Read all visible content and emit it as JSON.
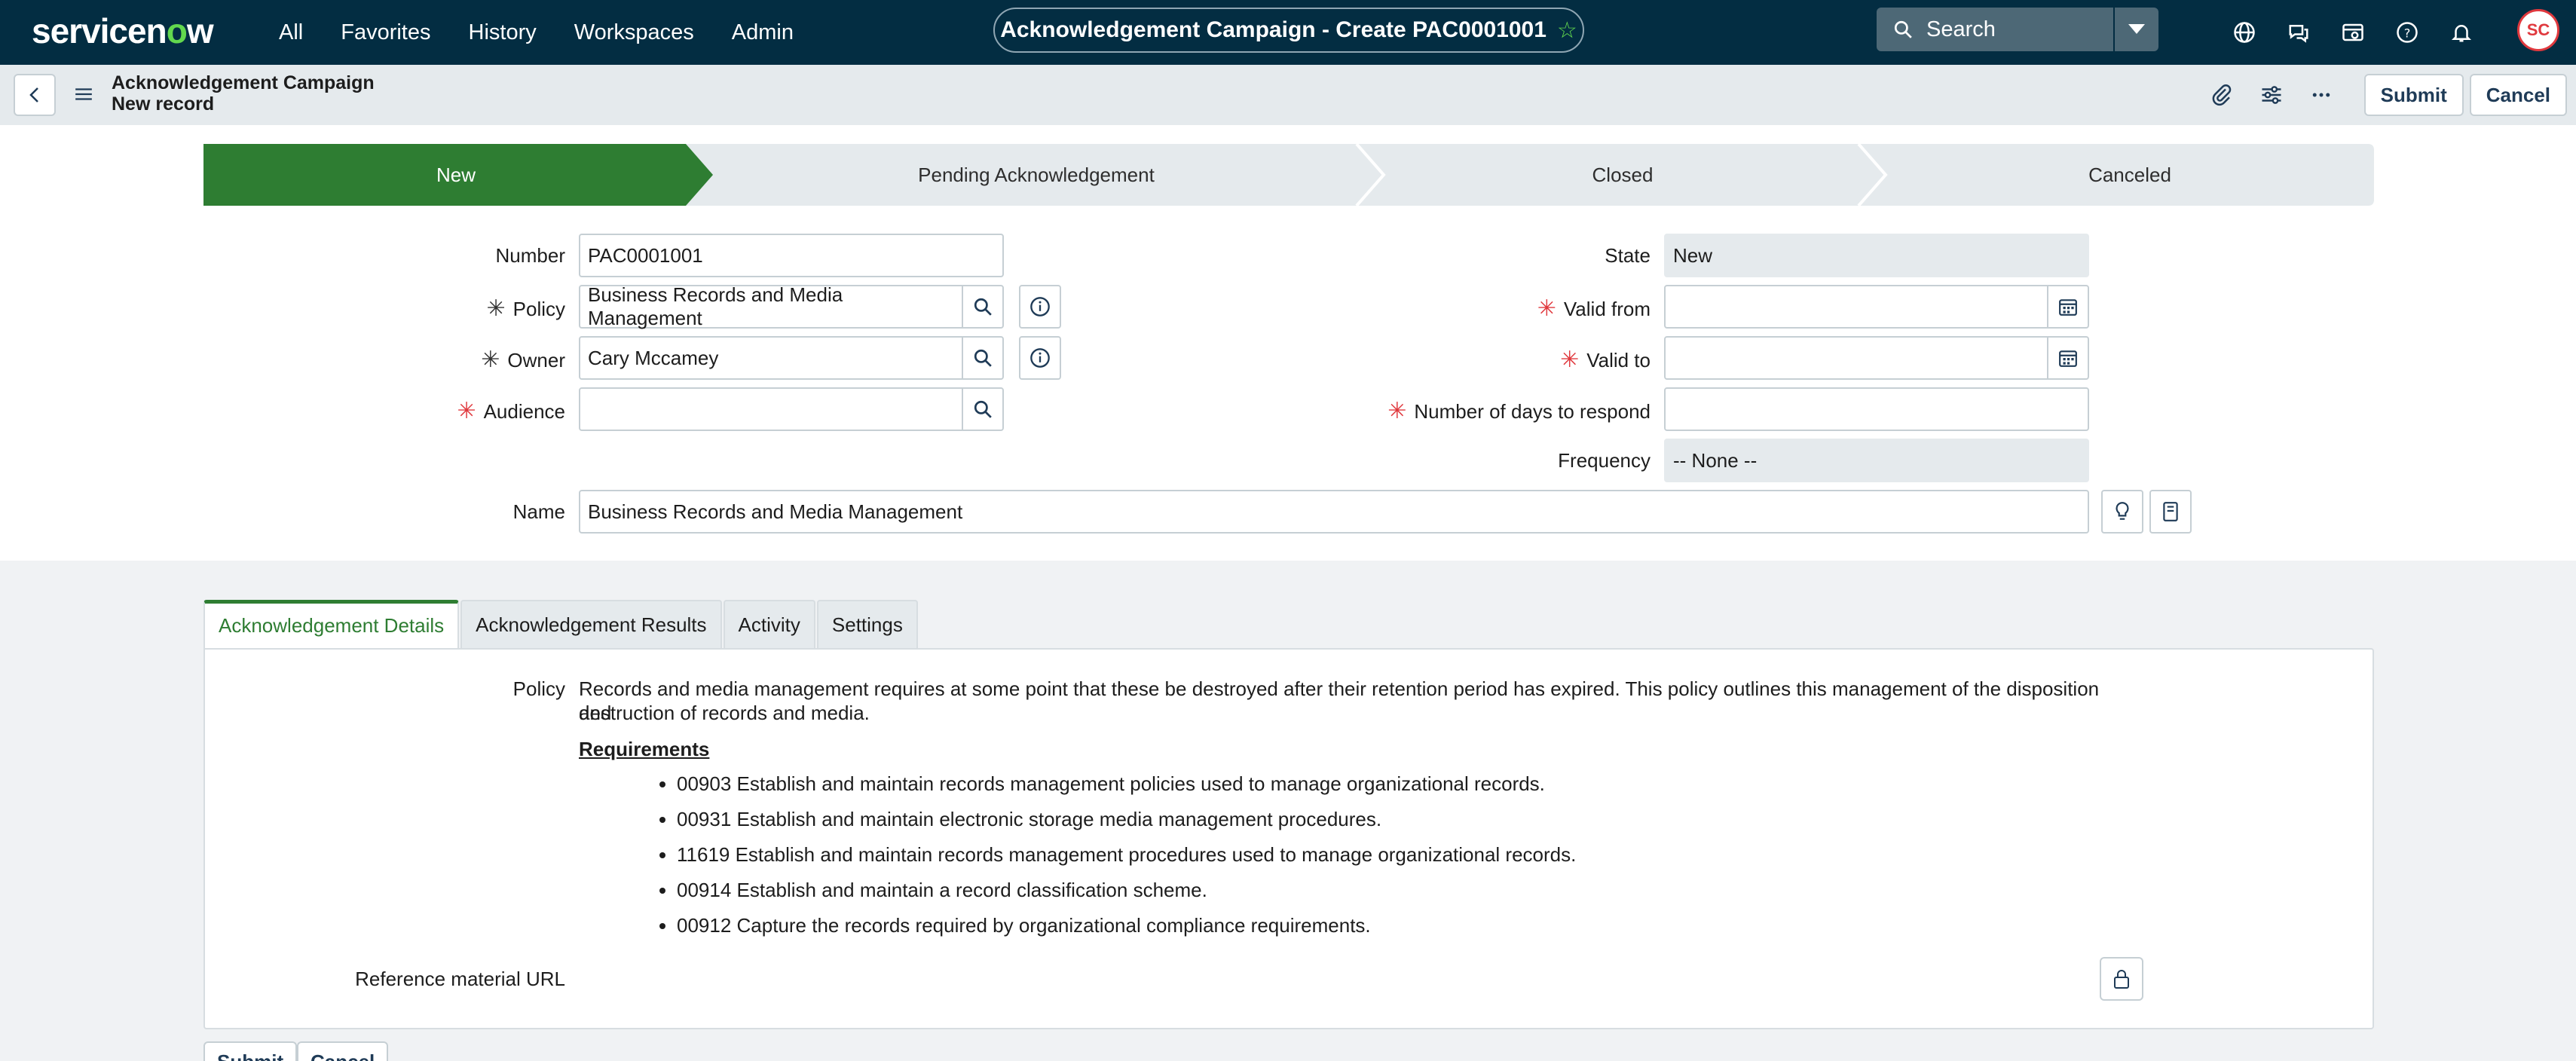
{
  "brand": {
    "name_a": "servicen",
    "name_o": "o",
    "name_b": "w"
  },
  "nav": {
    "links": [
      "All",
      "Favorites",
      "History",
      "Workspaces",
      "Admin"
    ]
  },
  "window": {
    "title": "Acknowledgement Campaign - Create PAC0001001"
  },
  "search": {
    "placeholder": "Search"
  },
  "user": {
    "initials": "SC"
  },
  "header": {
    "line1": "Acknowledgement Campaign",
    "line2": "New record",
    "submit": "Submit",
    "cancel": "Cancel"
  },
  "stages": [
    "New",
    "Pending Acknowledgement",
    "Closed",
    "Canceled"
  ],
  "form": {
    "number": {
      "label": "Number",
      "value": "PAC0001001"
    },
    "policy": {
      "label": "Policy",
      "value": "Business Records and Media Management"
    },
    "owner": {
      "label": "Owner",
      "value": "Cary Mccamey"
    },
    "audience": {
      "label": "Audience",
      "value": ""
    },
    "state": {
      "label": "State",
      "value": "New"
    },
    "valid_from": {
      "label": "Valid from",
      "value": ""
    },
    "valid_to": {
      "label": "Valid to",
      "value": ""
    },
    "days_to_respond": {
      "label": "Number of days to respond",
      "value": ""
    },
    "frequency": {
      "label": "Frequency",
      "value": "-- None --"
    },
    "name": {
      "label": "Name",
      "value": "Business Records and Media Management"
    }
  },
  "tabs": [
    "Acknowledgement Details",
    "Acknowledgement Results",
    "Activity",
    "Settings"
  ],
  "details": {
    "policy_label": "Policy",
    "policy_text_1": "Records and media management requires at some point that these be destroyed after their retention period has expired. This policy outlines this management of the disposition and",
    "policy_text_2": "destruction of records and media.",
    "requirements_heading": "Requirements",
    "requirements": [
      "00903 Establish and maintain records management policies used to manage organizational records.",
      "00931 Establish and maintain electronic storage media management procedures.",
      "11619 Establish and maintain records management procedures used to manage organizational records.",
      "00914 Establish and maintain a record classification scheme.",
      "00912 Capture the records required by organizational compliance requirements."
    ],
    "reference_label": "Reference material URL"
  },
  "footer": {
    "submit": "Submit",
    "cancel": "Cancel"
  },
  "colors": {
    "nav_bg": "#032d42",
    "accent_green": "#2e7d32",
    "logo_green": "#62d84e",
    "required_red": "#e0393e"
  }
}
